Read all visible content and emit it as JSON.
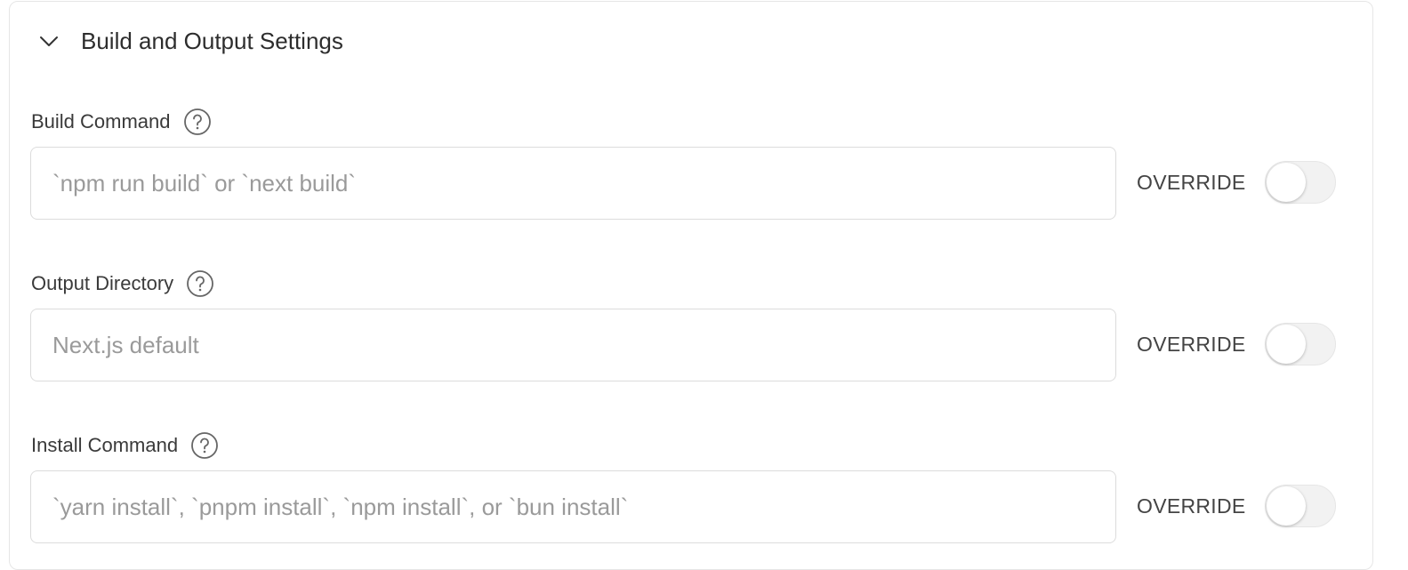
{
  "section": {
    "title": "Build and Output Settings",
    "expanded": true
  },
  "fields": [
    {
      "label": "Build Command",
      "placeholder": "`npm run build` or `next build`",
      "value": "",
      "override_label": "OVERRIDE",
      "override_enabled": false
    },
    {
      "label": "Output Directory",
      "placeholder": "Next.js default",
      "value": "",
      "override_label": "OVERRIDE",
      "override_enabled": false
    },
    {
      "label": "Install Command",
      "placeholder": "`yarn install`, `pnpm install`, `npm install`, or `bun install`",
      "value": "",
      "override_label": "OVERRIDE",
      "override_enabled": false
    }
  ],
  "icons": {
    "collapse": "chevron-down-icon",
    "help": "help-circle-icon"
  },
  "colors": {
    "border": "#dcdcdc",
    "placeholder": "#9a9a9a",
    "toggle_off": "#f2f2f2",
    "text": "#2d2d2d"
  }
}
